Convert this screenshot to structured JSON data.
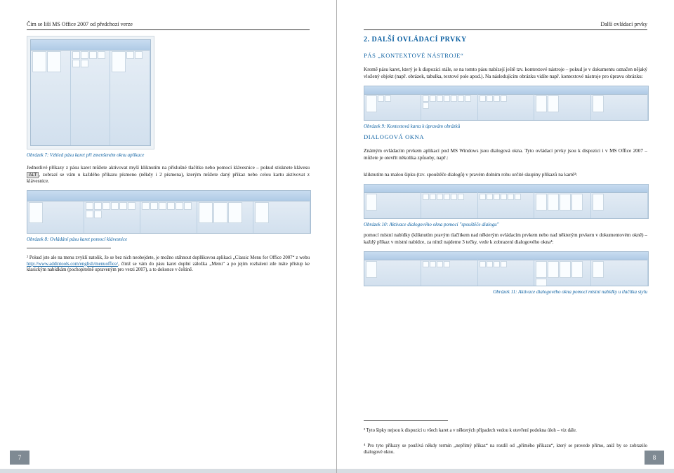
{
  "left": {
    "header": "Čím se liší MS Office 2007 od předchozí verze",
    "caption7": "Obrázek 7: Vzhled pásu karet při zmenšeném oknu aplikace",
    "para1": "Jednotlivé příkazy z pásu karet můžete aktivovat myší kliknutím na příslušné tlačítko nebo pomocí klávesnice – pokud stisknete klávesu ",
    "alt": "ALT",
    "para1b": ", zobrazí se vám u každého příkazu písmeno (někdy i 2 písmena), kterým můžete daný příkaz nebo celou kartu aktivovat z klávesnice.",
    "caption8": "Obrázek 8: Ovládání pásu karet pomocí klávesnice",
    "footnote2": "² Pokud jste ale na menu zvyklí natolik, že se bez nich neobejdete, je možno stáhnout doplňkovou aplikaci „Classic Menu for Office 2007“ z webu ",
    "footnote2link": "http://www.addintools.com/english/menuoffice/",
    "footnote2b": ", čímž se vám do pásu karet doplní záložka „Menu“ a po jejím rozbalení zde máte přístup ke klasickým nabídkám (pochopitelně upraveným pro verzi 2007), a to dokonce v češtině.",
    "pagenum": "7"
  },
  "right": {
    "header": "Další ovládací prvky",
    "h2": "2. DALŠÍ OVLÁDACÍ PRVKY",
    "h3a": "PÁS „KONTEXTOVÉ NÁSTROJE“",
    "para_a": "Kromě pásu karet, který je k dispozici stále, se na tomto pásu nabízejí ještě tzv. kontextové nástroje – pokud je v dokumentu označen nějaký vložený objekt (např. obrázek, tabulka, textové pole apod.). Na následujícím obrázku vidíte např. kontextové nástroje pro úpravu obrázku:",
    "caption9": "Obrázek 9: Kontextová karta k úpravám obrázků",
    "h3b": "DIALOGOVÁ OKNA",
    "para_b": "Známým ovládacím prvkem aplikací pod MS Windows jsou dialogová okna. Tyto ovládací prvky jsou k dispozici i v MS Office 2007 – můžete je otevřít několika způsoby, např.:",
    "para_c": "kliknutím na malou šipku (tzv. spouštěče dialogů) v pravém dolním rohu určité skupiny příkazů na kartě³:",
    "caption10": "Obrázek 10: Aktivace dialogového okna pomocí \"spouštěče dialogu\"",
    "para_d": "pomocí místní nabídky (kliknutím pravým tlačítkem nad některým ovládacím prvkem nebo nad některým prvkem v dokumentovém okně) – každý příkaz v místní nabídce, za nímž najdeme 3 tečky, vede k zobrazení dialogového okna⁴:",
    "caption11": "Obrázek 11: Aktivace dialogového okna pomocí místní nabídky u tlačítka stylu",
    "footnote3": "³ Tyto šipky nejsou k dispozici u všech karet a v některých případech vedou k otevření podokna úloh – viz dále.",
    "footnote4": "⁴ Pro tyto příkazy se používá někdy termín „nepřímý příkaz“ na rozdíl od „přímého příkazu“, který se provede přímo, aniž by se zobrazilo dialogové okno.",
    "pagenum": "8"
  }
}
